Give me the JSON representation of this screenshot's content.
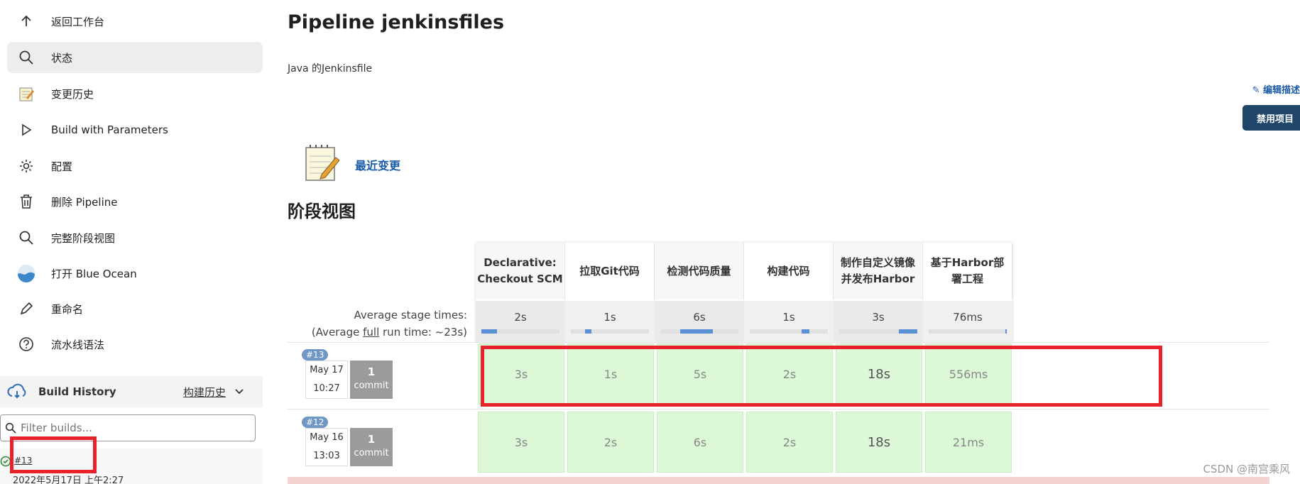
{
  "sidebar": {
    "items": [
      {
        "label": "返回工作台",
        "icon": "arrow-up-icon"
      },
      {
        "label": "状态",
        "icon": "search-icon"
      },
      {
        "label": "变更历史",
        "icon": "notepad-icon"
      },
      {
        "label": "Build with Parameters",
        "icon": "play-icon"
      },
      {
        "label": "配置",
        "icon": "gear-icon"
      },
      {
        "label": "删除 Pipeline",
        "icon": "trash-icon"
      },
      {
        "label": "完整阶段视图",
        "icon": "search-icon"
      },
      {
        "label": "打开 Blue Ocean",
        "icon": "blue-ocean-icon"
      },
      {
        "label": "重命名",
        "icon": "pencil-icon"
      },
      {
        "label": "流水线语法",
        "icon": "help-icon"
      }
    ],
    "build_history": {
      "title": "Build History",
      "title_cn": "构建历史"
    },
    "filter_placeholder": "Filter builds...",
    "latest_build": {
      "number": "#13",
      "date": "2022年5月17日 上午2:27"
    }
  },
  "main": {
    "title": "Pipeline jenkinsfiles",
    "description": "Java 的Jenkinsfile",
    "edit_description": "编辑描述",
    "disable_button": "禁用项目",
    "recent_changes": "最近变更",
    "stage_view_title": "阶段视图",
    "avg_label_1": "Average stage times:",
    "avg_label_2_prefix": "(Average ",
    "avg_label_2_full": "full",
    "avg_label_2_suffix": " run time: ~23s)",
    "stages": [
      {
        "name_l1": "Declarative:",
        "name_l2": "Checkout SCM",
        "avg": "2s",
        "avg_fill": 0.2
      },
      {
        "name_l1": "拉取Git代码",
        "name_l2": "",
        "avg": "1s",
        "avg_fill": 0.1
      },
      {
        "name_l1": "检测代码质量",
        "name_l2": "",
        "avg": "6s",
        "avg_fill": 0.45
      },
      {
        "name_l1": "构建代码",
        "name_l2": "",
        "avg": "1s",
        "avg_fill": 0.1
      },
      {
        "name_l1": "制作自定义镜像",
        "name_l2": "并发布Harbor",
        "avg": "3s",
        "avg_fill": 0.25
      },
      {
        "name_l1": "基于Harbor部",
        "name_l2": "署工程",
        "avg": "76ms",
        "avg_fill": 0.02
      }
    ],
    "runs": [
      {
        "badge": "#13",
        "month_day": "May 17",
        "time": "10:27",
        "commits_num": "1",
        "commits_label": "commit",
        "times": [
          "3s",
          "1s",
          "5s",
          "2s",
          "18s",
          "556ms"
        ]
      },
      {
        "badge": "#12",
        "month_day": "May 16",
        "time": "13:03",
        "commits_num": "1",
        "commits_label": "commit",
        "times": [
          "3s",
          "2s",
          "6s",
          "2s",
          "18s",
          "21ms"
        ]
      }
    ]
  },
  "watermark": "CSDN @南宫乘风"
}
